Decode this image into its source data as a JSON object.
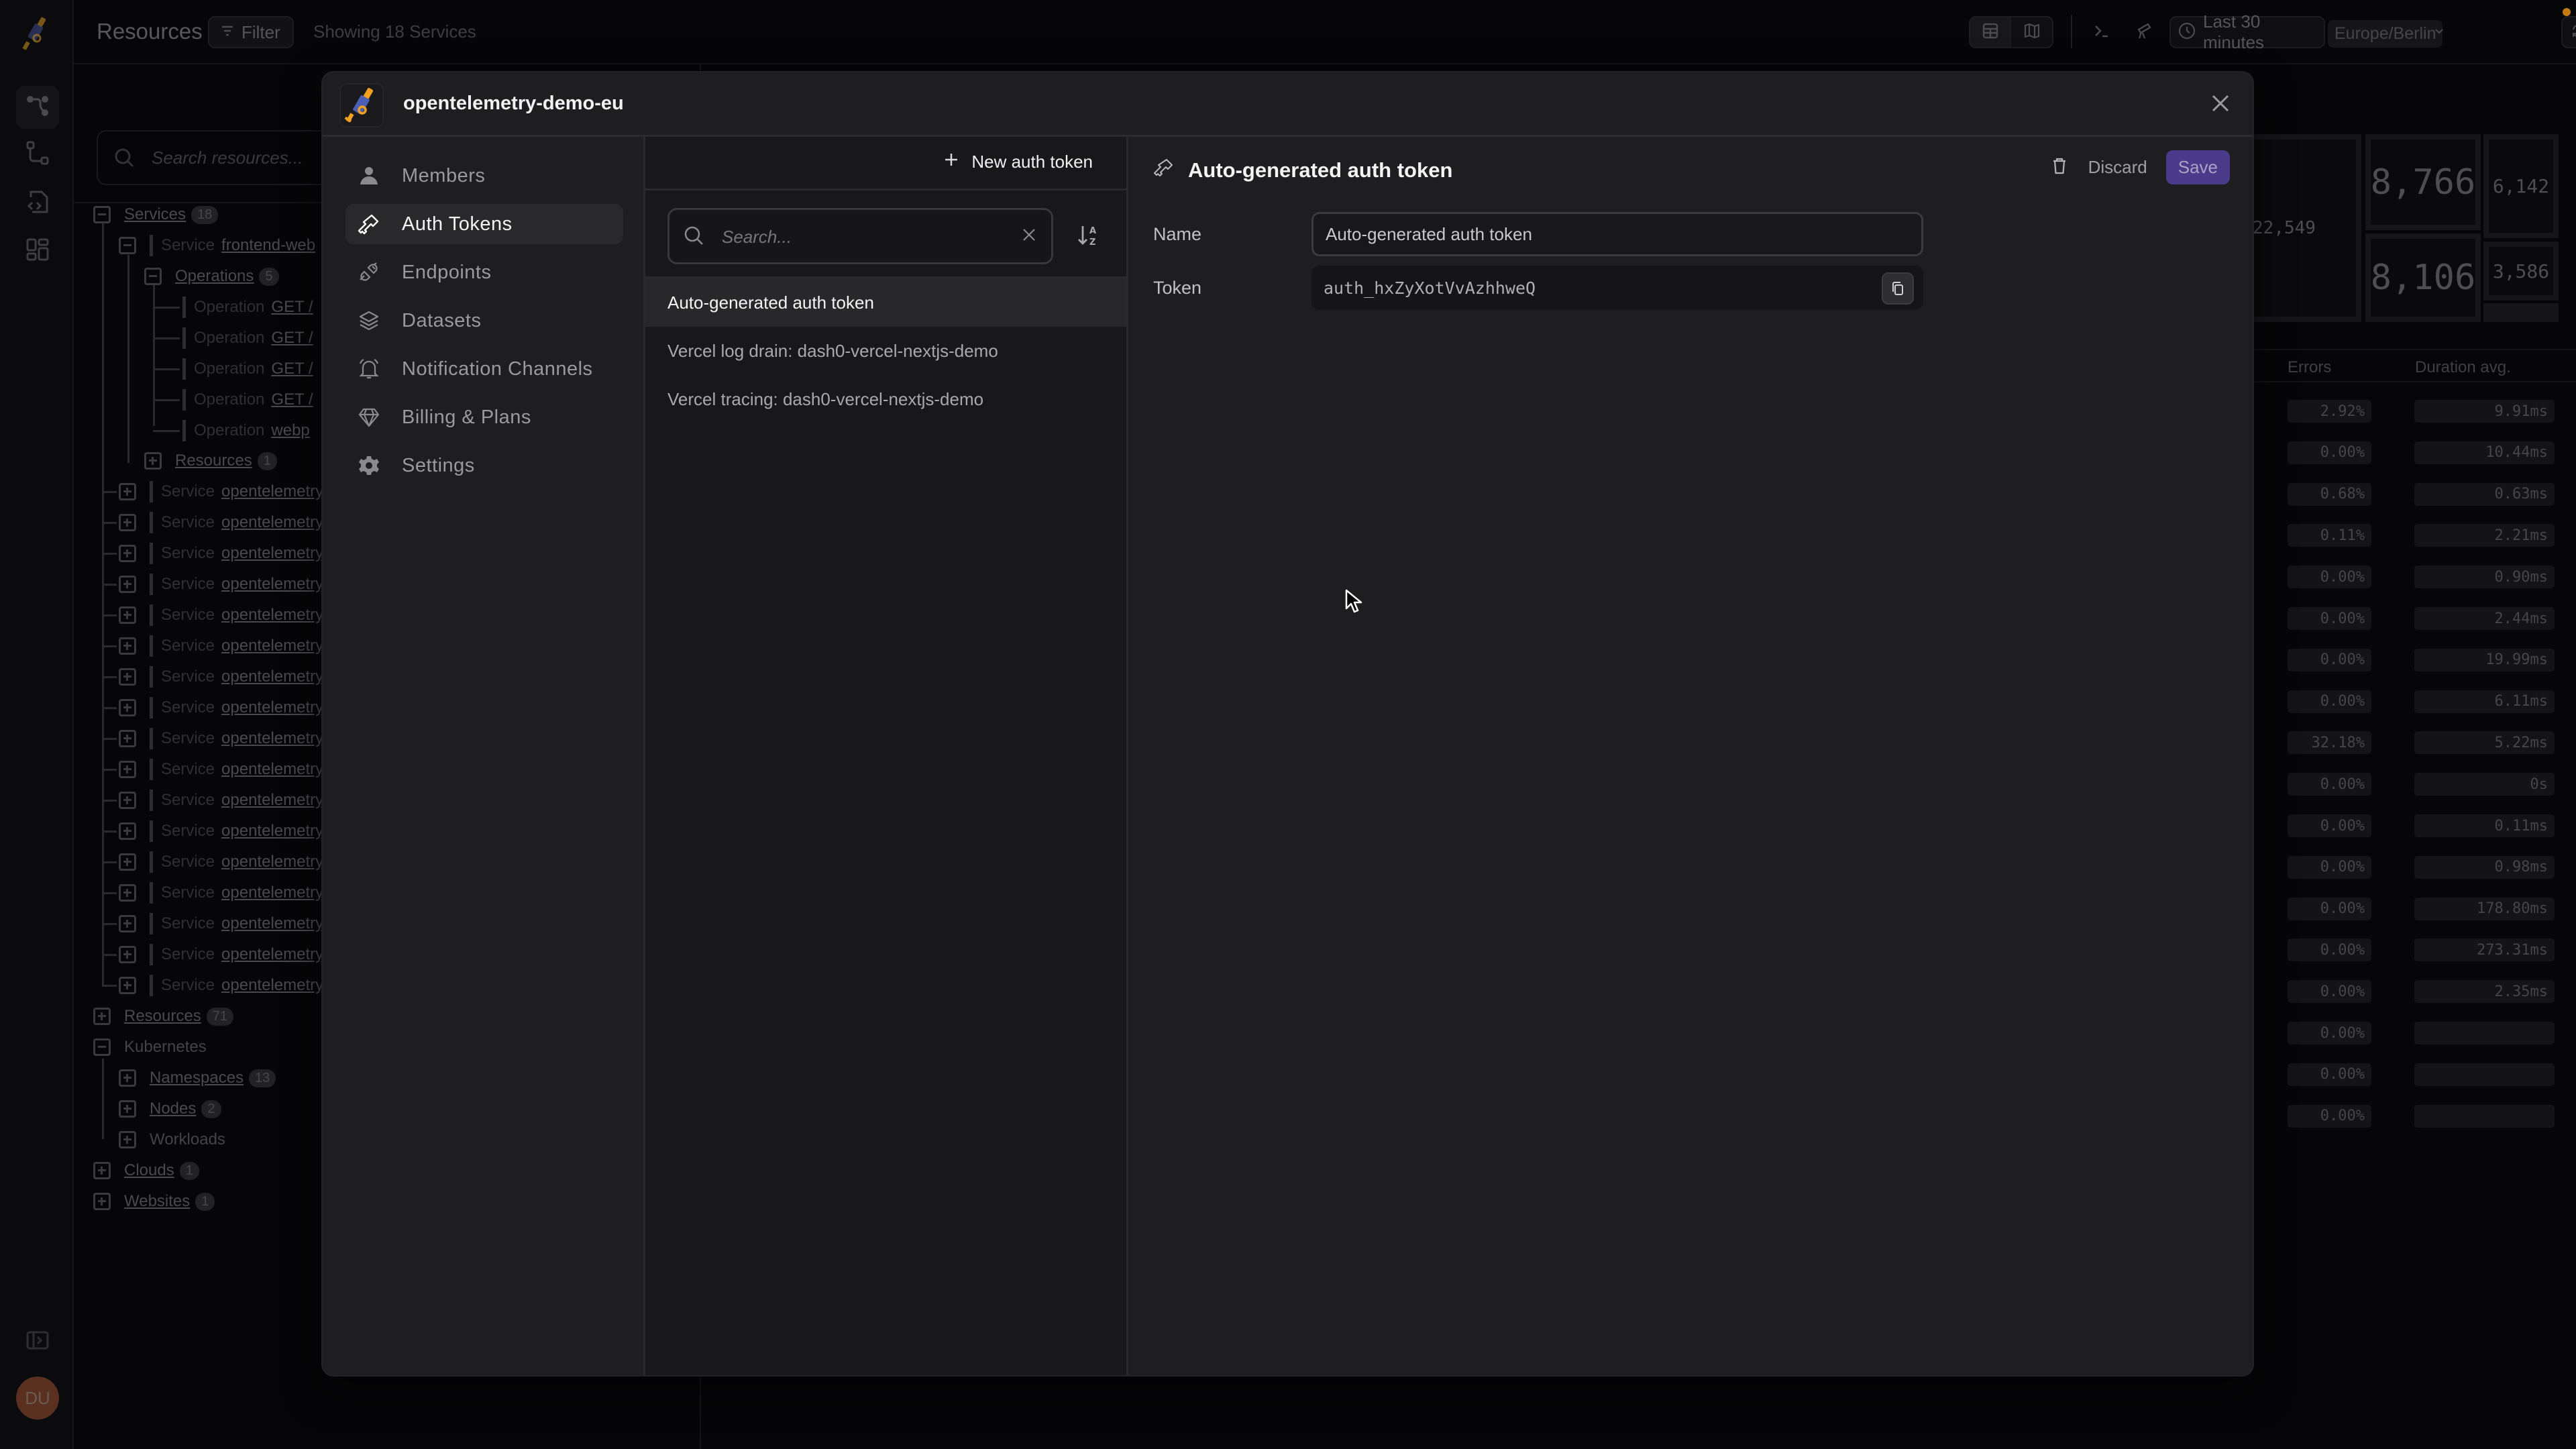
{
  "app": {
    "page_title": "Resources",
    "filter_label": "Filter",
    "showing_text": "Showing 18 Services",
    "time_range": "Last 30 minutes",
    "timezone": "Europe/Berlin",
    "avatar_initials": "DU",
    "colors": {
      "accent": "#4a3a8a",
      "notification_dot": "#c67b10",
      "brand_blue": "#4a5fb5",
      "brand_orange": "#f0a020"
    }
  },
  "resource_tree": {
    "search_placeholder": "Search resources...",
    "services": {
      "label": "Services",
      "count": "18"
    },
    "frontend_service": {
      "kind": "Service",
      "name": "frontend-web"
    },
    "operations": {
      "label": "Operations",
      "count": "5"
    },
    "operation_items": [
      {
        "kind": "Operation",
        "name": "GET /"
      },
      {
        "kind": "Operation",
        "name": "GET /"
      },
      {
        "kind": "Operation",
        "name": "GET /"
      },
      {
        "kind": "Operation",
        "name": "GET /"
      },
      {
        "kind": "Operation",
        "name": "webp"
      }
    ],
    "service_resources": {
      "label": "Resources",
      "count": "1"
    },
    "other_services": [
      {
        "kind": "Service",
        "name": "opentelemetry"
      },
      {
        "kind": "Service",
        "name": "opentelemetry"
      },
      {
        "kind": "Service",
        "name": "opentelemetry"
      },
      {
        "kind": "Service",
        "name": "opentelemetry"
      },
      {
        "kind": "Service",
        "name": "opentelemetry"
      },
      {
        "kind": "Service",
        "name": "opentelemetry"
      },
      {
        "kind": "Service",
        "name": "opentelemetry"
      },
      {
        "kind": "Service",
        "name": "opentelemetry"
      },
      {
        "kind": "Service",
        "name": "opentelemetry"
      },
      {
        "kind": "Service",
        "name": "opentelemetry"
      },
      {
        "kind": "Service",
        "name": "opentelemetry"
      },
      {
        "kind": "Service",
        "name": "opentelemetry"
      },
      {
        "kind": "Service",
        "name": "opentelemetry"
      },
      {
        "kind": "Service",
        "name": "opentelemetry"
      },
      {
        "kind": "Service",
        "name": "opentelemetry"
      },
      {
        "kind": "Service",
        "name": "opentelemetry"
      },
      {
        "kind": "Service",
        "name": "opentelemetry"
      }
    ],
    "resources": {
      "label": "Resources",
      "count": "71"
    },
    "kubernetes": {
      "label": "Kubernetes"
    },
    "namespaces": {
      "label": "Namespaces",
      "count": "13"
    },
    "nodes": {
      "label": "Nodes",
      "count": "2"
    },
    "workloads": {
      "label": "Workloads"
    },
    "clouds": {
      "label": "Clouds",
      "count": "1"
    },
    "websites": {
      "label": "Websites",
      "count": "1"
    }
  },
  "tiles": [
    "22,549",
    "8,766",
    "6,142",
    "8,106",
    "3,586"
  ],
  "table": {
    "headers": {
      "errors": "Errors",
      "duration": "Duration avg."
    },
    "rows": [
      {
        "errors": "2.92%",
        "duration": "9.91ms"
      },
      {
        "errors": "0.00%",
        "duration": "10.44ms"
      },
      {
        "errors": "0.68%",
        "duration": "0.63ms"
      },
      {
        "errors": "0.11%",
        "duration": "2.21ms"
      },
      {
        "errors": "0.00%",
        "duration": "0.90ms"
      },
      {
        "errors": "0.00%",
        "duration": "2.44ms"
      },
      {
        "errors": "0.00%",
        "duration": "19.99ms"
      },
      {
        "errors": "0.00%",
        "duration": "6.11ms"
      },
      {
        "errors": "32.18%",
        "duration": "5.22ms"
      },
      {
        "errors": "0.00%",
        "duration": "0s"
      },
      {
        "errors": "0.00%",
        "duration": "0.11ms"
      },
      {
        "errors": "0.00%",
        "duration": "0.98ms"
      },
      {
        "errors": "0.00%",
        "duration": "178.80ms"
      },
      {
        "errors": "0.00%",
        "duration": "273.31ms"
      },
      {
        "errors": "0.00%",
        "duration": "2.35ms"
      },
      {
        "errors": "0.00%",
        "duration": ""
      },
      {
        "errors": "0.00%",
        "duration": ""
      },
      {
        "errors": "0.00%",
        "duration": ""
      }
    ]
  },
  "modal": {
    "org_name": "opentelemetry-demo-eu",
    "nav": [
      {
        "label": "Members",
        "icon": "user-icon"
      },
      {
        "label": "Auth Tokens",
        "icon": "key-icon",
        "active": true
      },
      {
        "label": "Endpoints",
        "icon": "plug-icon"
      },
      {
        "label": "Datasets",
        "icon": "layers-icon"
      },
      {
        "label": "Notification Channels",
        "icon": "bell-icon"
      },
      {
        "label": "Billing & Plans",
        "icon": "diamond-icon"
      },
      {
        "label": "Settings",
        "icon": "gear-icon"
      }
    ],
    "list": {
      "new_button": "New auth token",
      "search_placeholder": "Search...",
      "search_value": "",
      "tokens": [
        {
          "name": "Auto-generated auth token",
          "active": true
        },
        {
          "name": "Vercel log drain: dash0-vercel-nextjs-demo"
        },
        {
          "name": "Vercel tracing: dash0-vercel-nextjs-demo"
        }
      ]
    },
    "detail": {
      "title": "Auto-generated auth token",
      "discard_label": "Discard",
      "save_label": "Save",
      "name_label": "Name",
      "name_value": "Auto-generated auth token",
      "token_label": "Token",
      "token_value": "auth_hxZyXotVvAzhhweQ"
    }
  }
}
